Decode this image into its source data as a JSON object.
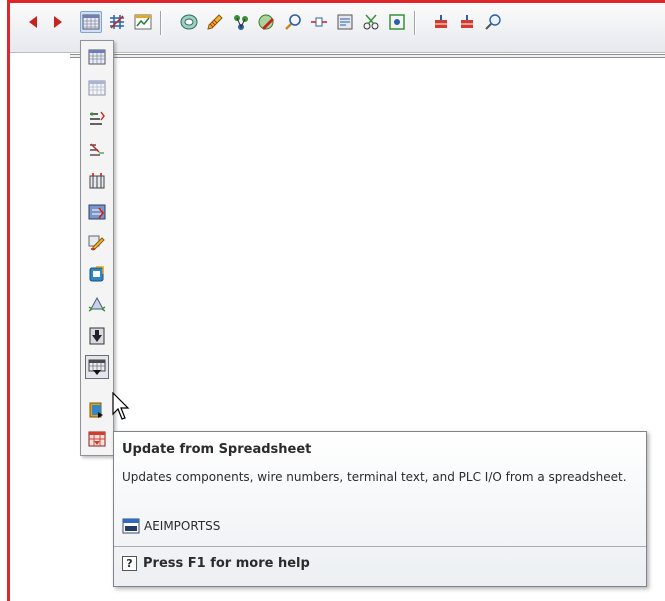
{
  "toolbar": {
    "buttons": [
      {
        "icon": "arrow-left-icon"
      },
      {
        "icon": "arrow-right-icon"
      },
      {
        "icon": "spreadsheet-icon"
      },
      {
        "icon": "grid-cross-icon"
      },
      {
        "icon": "chart-window-icon"
      },
      {
        "icon": "reel-icon"
      },
      {
        "icon": "striped-pencil-icon"
      },
      {
        "icon": "fork-icon"
      },
      {
        "icon": "ring-pencil-icon"
      },
      {
        "icon": "magnifier-icon"
      },
      {
        "icon": "terminal-connect-icon"
      },
      {
        "icon": "panel-icon"
      },
      {
        "icon": "scissors-icon"
      },
      {
        "icon": "target-square-icon"
      },
      {
        "icon": "red-component-icon"
      },
      {
        "icon": "red-component-alt-icon"
      },
      {
        "icon": "zoom-icon"
      }
    ]
  },
  "flyout": {
    "items": [
      {
        "icon": "spreadsheet-icon"
      },
      {
        "icon": "spreadsheet-light-icon"
      },
      {
        "icon": "wire-number-icon"
      },
      {
        "icon": "wire-label-icon"
      },
      {
        "icon": "terminal-strip-icon"
      },
      {
        "icon": "plc-module-icon"
      },
      {
        "icon": "edit-pencil-icon"
      },
      {
        "icon": "export-icon"
      },
      {
        "icon": "triangle-arrows-icon"
      },
      {
        "icon": "import-arrow-icon"
      },
      {
        "icon": "update-from-spreadsheet-icon"
      },
      {
        "icon": "book-export-icon"
      },
      {
        "icon": "red-table-icon"
      }
    ],
    "hovered_index": 10
  },
  "tooltip": {
    "title": "Update from Spreadsheet",
    "description": "Updates components, wire numbers, terminal text, and PLC I/O from a spreadsheet.",
    "command_icon": "command-window-icon",
    "command": "AEIMPORTSS",
    "help_icon": "help-question-icon",
    "help_symbol": "?",
    "help_text": "Press F1 for more help"
  },
  "colors": {
    "frame_red": "#e0262a",
    "tooltip_border": "#7f848b",
    "hover_border": "#6b6f75"
  }
}
